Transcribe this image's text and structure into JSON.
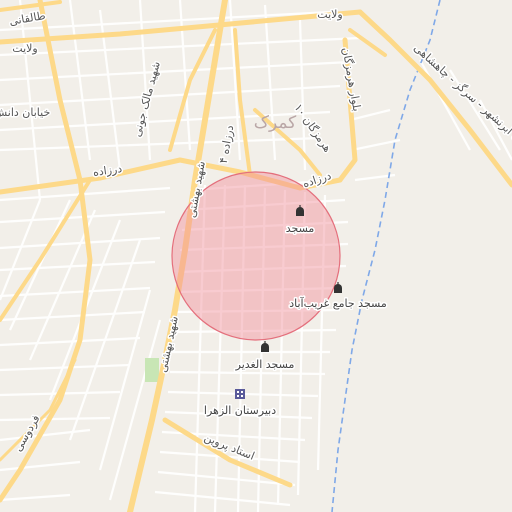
{
  "map": {
    "district": "کمرک",
    "roads": {
      "valiat_top": "ولایت",
      "valiat_left": "ولایت",
      "taleghani": "طالقانی",
      "khiaban_left": "خیابان دانش",
      "malek_jouni": "شهید مالک جونی",
      "dorrazeh_4": "درزاده ۴",
      "dorrazeh_left": "درزاده",
      "dorrazeh_right": "درزاده",
      "hormozgan_blvd": "بلوار هرمزگان",
      "hormozgan_10": "هرمزگان ۱۰",
      "beheshti_top": "شهید بهشتی",
      "beheshti_bottom": "شهید بهشتی",
      "ferdousi": "فردوسی",
      "ostad_parvin": "استاد پروین",
      "jadeh": "جاده ابرنشهر - سرگز - چاهشاهی"
    },
    "pois": [
      {
        "name": "مسجد",
        "icon": "mosque-icon"
      },
      {
        "name": "مسجد جامع غریب‌آباد",
        "icon": "mosque-icon"
      },
      {
        "name": "مسجد الغدیر",
        "icon": "mosque-icon"
      },
      {
        "name": "دبیرستان الزهرا",
        "icon": "school-icon"
      }
    ],
    "colors": {
      "land": "#f2efe9",
      "major_road": "#fdd989",
      "minor_road": "#ffffff",
      "water": "#7fa8e8",
      "park": "#c8e6b5",
      "highlight_fill": "#f28e9a",
      "highlight_stroke": "#e46f7c"
    }
  }
}
